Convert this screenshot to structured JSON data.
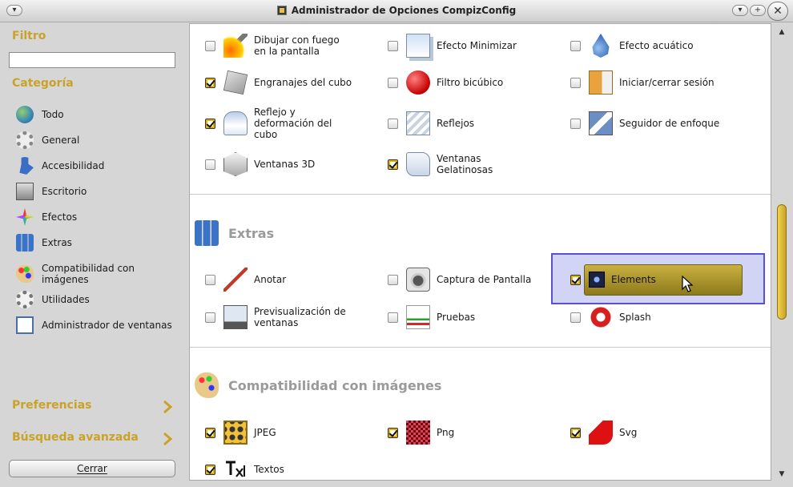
{
  "window": {
    "title": "Administrador de Opciones CompizConfig"
  },
  "sidebar": {
    "filter_label": "Filtro",
    "filter_value": "",
    "category_label": "Categoría",
    "categories": [
      {
        "label": "Todo",
        "icon": "globe-icon"
      },
      {
        "label": "General",
        "icon": "gear-icon"
      },
      {
        "label": "Accesibilidad",
        "icon": "accessibility-icon"
      },
      {
        "label": "Escritorio",
        "icon": "desktop-icon"
      },
      {
        "label": "Efectos",
        "icon": "effects-icon"
      },
      {
        "label": "Extras",
        "icon": "extras-icon"
      },
      {
        "label": "Compatibilidad con imágenes",
        "icon": "palette-icon"
      },
      {
        "label": "Utilidades",
        "icon": "utilities-icon"
      },
      {
        "label": "Administrador de ventanas",
        "icon": "window-manager-icon"
      }
    ],
    "preferences_label": "Preferencias",
    "advanced_search_label": "Búsqueda avanzada",
    "close_label": "Cerrar"
  },
  "sections": {
    "effects_plugins": [
      {
        "label": "Dibujar con fuego en la pantalla",
        "checked": false
      },
      {
        "label": "Efecto Minimizar",
        "checked": false
      },
      {
        "label": "Efecto acuático",
        "checked": false
      },
      {
        "label": "Engranajes del cubo",
        "checked": true
      },
      {
        "label": "Filtro bicúbico",
        "checked": false
      },
      {
        "label": "Iniciar/cerrar sesión",
        "checked": false
      },
      {
        "label": "Reflejo y deformación del cubo",
        "checked": true
      },
      {
        "label": "Reflejos",
        "checked": false
      },
      {
        "label": "Seguidor de enfoque",
        "checked": false
      },
      {
        "label": "Ventanas 3D",
        "checked": false
      },
      {
        "label": "Ventanas Gelatinosas",
        "checked": true
      }
    ],
    "extras": {
      "title": "Extras",
      "plugins": [
        {
          "label": "Anotar",
          "checked": false
        },
        {
          "label": "Captura de Pantalla",
          "checked": false
        },
        {
          "label": "Elements",
          "checked": true
        },
        {
          "label": "Previsualización de ventanas",
          "checked": false
        },
        {
          "label": "Pruebas",
          "checked": false
        },
        {
          "label": "Splash",
          "checked": false
        }
      ]
    },
    "image_compat": {
      "title": "Compatibilidad con imágenes",
      "plugins": [
        {
          "label": "JPEG",
          "checked": true
        },
        {
          "label": "Png",
          "checked": true
        },
        {
          "label": "Svg",
          "checked": true
        },
        {
          "label": "Textos",
          "checked": true
        }
      ]
    }
  }
}
